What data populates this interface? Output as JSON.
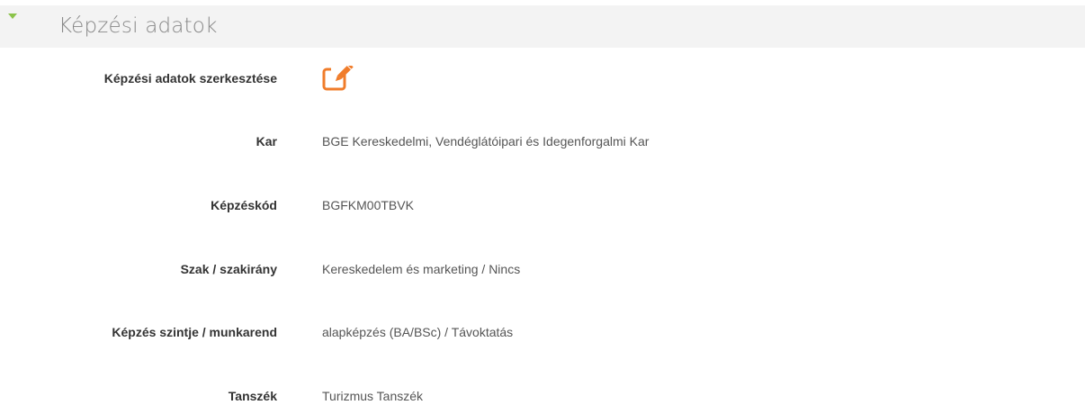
{
  "section": {
    "title": "Képzési adatok",
    "accent_color": "#8bc34a"
  },
  "edit": {
    "label": "Képzési adatok szerkesztése",
    "icon": "edit-pencil-square-icon",
    "icon_color": "#f07c2a"
  },
  "fields": [
    {
      "label": "Kar",
      "value": "BGE Kereskedelmi, Vendéglátóipari és Idegenforgalmi Kar"
    },
    {
      "label": "Képzéskód",
      "value": "BGFKM00TBVK"
    },
    {
      "label": "Szak / szakirány",
      "value": "Kereskedelem és marketing / Nincs"
    },
    {
      "label": "Képzés szintje / munkarend",
      "value": "alapképzés (BA/BSc) / Távoktatás"
    },
    {
      "label": "Tanszék",
      "value": "Turizmus Tanszék"
    }
  ]
}
